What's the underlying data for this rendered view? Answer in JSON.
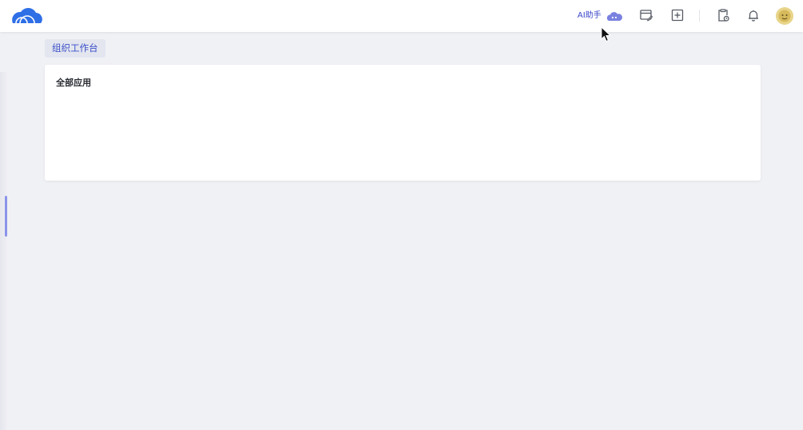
{
  "header": {
    "logo_icon": "cloud-logo-icon",
    "ai_assistant_label": "AI助手",
    "ai_assistant_icon": "ai-cloud-icon",
    "actions": [
      {
        "name": "calendar-edit-icon"
      },
      {
        "name": "add-square-icon"
      },
      {
        "name": "clipboard-clock-icon"
      },
      {
        "name": "bell-icon"
      }
    ],
    "avatar_icon": "user-avatar-icon"
  },
  "workspace": {
    "tag_label": "组织工作台"
  },
  "apps_card": {
    "title": "全部应用"
  },
  "colors": {
    "brand_blue": "#3b47c8",
    "logo_blue": "#2f6fe6",
    "background": "#f0f1f5",
    "indicator": "#8b93e8"
  }
}
